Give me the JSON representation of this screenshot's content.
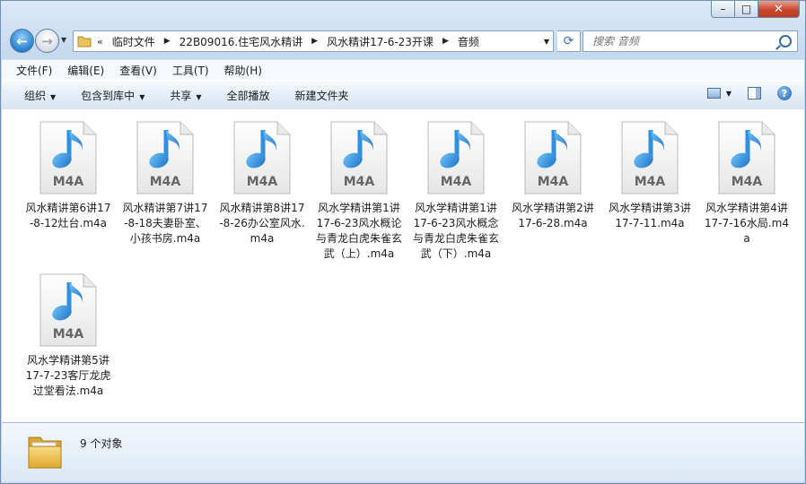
{
  "window": {
    "controls": {
      "minimize": "–",
      "maximize": "□",
      "close": "✕"
    }
  },
  "address": {
    "prefix": "«",
    "crumbs": [
      "临时文件",
      "22B09016.住宅风水精讲",
      "风水精讲17-6-23开课",
      "音频"
    ],
    "search_placeholder": "搜索 音频"
  },
  "menu": [
    "文件(F)",
    "编辑(E)",
    "查看(V)",
    "工具(T)",
    "帮助(H)"
  ],
  "commands": [
    {
      "label": "组织",
      "dropdown": true
    },
    {
      "label": "包含到库中",
      "dropdown": true
    },
    {
      "label": "共享",
      "dropdown": true
    },
    {
      "label": "全部播放",
      "dropdown": false
    },
    {
      "label": "新建文件夹",
      "dropdown": false
    }
  ],
  "files": [
    {
      "badge": "M4A",
      "name": "风水精讲第6讲17-8-12灶台.m4a"
    },
    {
      "badge": "M4A",
      "name": "风水精讲第7讲17-8-18夫妻卧室、小孩书房.m4a"
    },
    {
      "badge": "M4A",
      "name": "风水精讲第8讲17-8-26办公室风水.m4a"
    },
    {
      "badge": "M4A",
      "name": "风水学精讲第1讲17-6-23风水概论与青龙白虎朱雀玄武（上）.m4a"
    },
    {
      "badge": "M4A",
      "name": "风水学精讲第1讲17-6-23风水概念与青龙白虎朱雀玄武（下）.m4a"
    },
    {
      "badge": "M4A",
      "name": "风水学精讲第2讲17-6-28.m4a"
    },
    {
      "badge": "M4A",
      "name": "风水学精讲第3讲17-7-11.m4a"
    },
    {
      "badge": "M4A",
      "name": "风水学精讲第4讲17-7-16水局.m4a"
    },
    {
      "badge": "M4A",
      "name": "风水学精讲第5讲17-7-23客厅龙虎过堂看法.m4a"
    }
  ],
  "status": {
    "count_text": "9 个对象"
  },
  "colors": {
    "note_blue": "#2f8fe0",
    "accent": "#3a6fb0"
  }
}
